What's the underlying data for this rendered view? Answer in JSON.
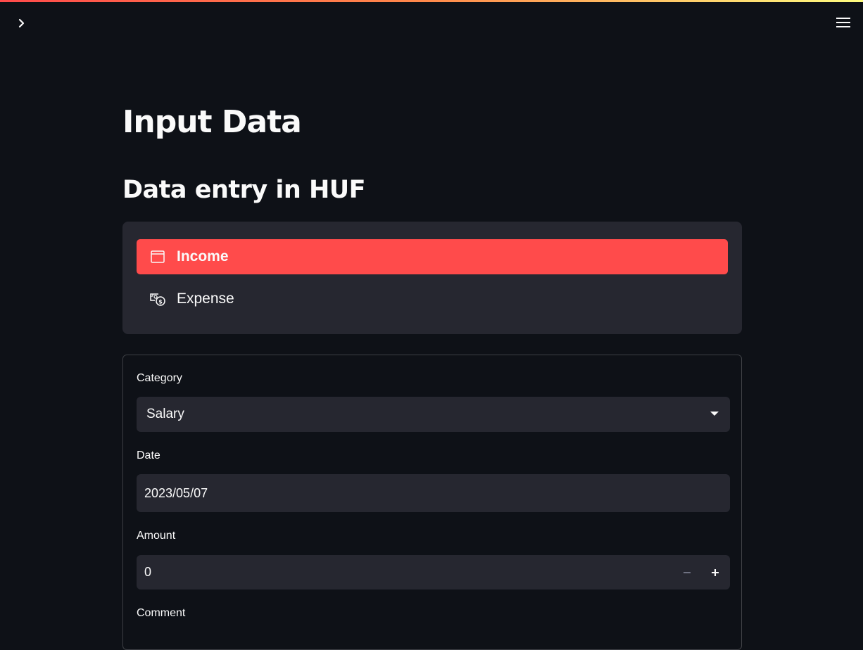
{
  "header": {
    "sidebar_toggle_icon": "chevron-right-icon",
    "menu_icon": "hamburger-menu-icon"
  },
  "page": {
    "title": "Input Data",
    "subheader": "Data entry in HUF"
  },
  "nav_menu": {
    "items": [
      {
        "label": "Income",
        "icon": "window-icon",
        "selected": true
      },
      {
        "label": "Expense",
        "icon": "cash-coin-icon",
        "selected": false
      }
    ],
    "active_color": "#ff4b4b"
  },
  "form": {
    "category": {
      "label": "Category",
      "value": "Salary"
    },
    "date": {
      "label": "Date",
      "value": "2023/05/07"
    },
    "amount": {
      "label": "Amount",
      "value": "0",
      "minus": "−",
      "plus": "+"
    },
    "comment": {
      "label": "Comment"
    }
  },
  "colors": {
    "background": "#0e1117",
    "panel": "#262730",
    "accent": "#ff4b4b",
    "text": "#fafafa"
  }
}
